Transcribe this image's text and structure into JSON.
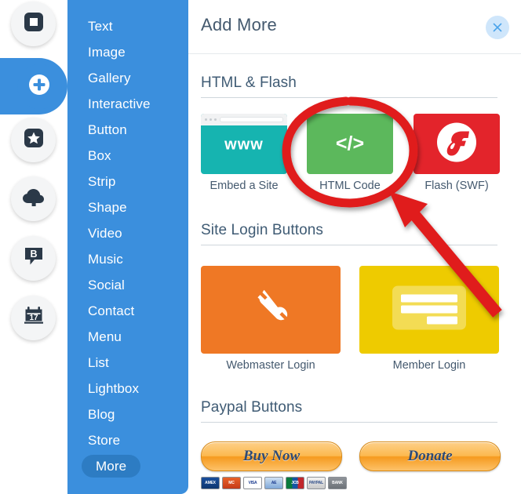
{
  "rail": {
    "items": [
      {
        "name": "pages-icon",
        "label": "Pages"
      },
      {
        "name": "add-icon",
        "label": "Add",
        "active": true
      },
      {
        "name": "star-icon",
        "label": "Favorites"
      },
      {
        "name": "cloud-upload-icon",
        "label": "Upload"
      },
      {
        "name": "blog-bubble-icon",
        "label": "Blog",
        "letter": "B"
      },
      {
        "name": "calendar-icon",
        "label": "Events",
        "day": "17"
      }
    ]
  },
  "sidebar": {
    "items": [
      {
        "label": "Text"
      },
      {
        "label": "Image"
      },
      {
        "label": "Gallery"
      },
      {
        "label": "Interactive"
      },
      {
        "label": "Button"
      },
      {
        "label": "Box"
      },
      {
        "label": "Strip"
      },
      {
        "label": "Shape"
      },
      {
        "label": "Video"
      },
      {
        "label": "Music"
      },
      {
        "label": "Social"
      },
      {
        "label": "Contact"
      },
      {
        "label": "Menu"
      },
      {
        "label": "List"
      },
      {
        "label": "Lightbox"
      },
      {
        "label": "Blog"
      },
      {
        "label": "Store"
      },
      {
        "label": "More",
        "selected": true
      }
    ]
  },
  "panel": {
    "title": "Add More",
    "close_label": "×",
    "sections": [
      {
        "title": "HTML & Flash",
        "cards": [
          {
            "label": "Embed a Site",
            "glyph": "www",
            "color": "#16b4b0"
          },
          {
            "label": "HTML Code",
            "glyph": "</>",
            "color": "#5cb85c",
            "highlighted": true
          },
          {
            "label": "Flash (SWF)",
            "glyph": "flash-icon",
            "color": "#e3242b"
          }
        ]
      },
      {
        "title": "Site Login Buttons",
        "cards": [
          {
            "label": "Webmaster Login",
            "glyph": "wrench-icon",
            "color": "#ef7825"
          },
          {
            "label": "Member Login",
            "glyph": "login-form-icon",
            "color": "#eecb00"
          }
        ]
      },
      {
        "title": "Paypal Buttons",
        "cards": [
          {
            "label": "Buy Now"
          },
          {
            "label": "Donate"
          }
        ],
        "payment_methods": [
          "AMEX",
          "MC",
          "VISA",
          "AE",
          "JCB",
          "PAYPAL",
          "BANK"
        ]
      }
    ]
  },
  "annotation": {
    "target": "HTML Code",
    "color": "#e01b1b",
    "shapes": [
      "ellipse-highlight",
      "arrow-pointer"
    ]
  },
  "colors": {
    "sidebar_blue": "#3b8fdd",
    "sidebar_selected": "#2d7cc3",
    "heading": "#44596e",
    "annotation_red": "#e01b1b"
  }
}
